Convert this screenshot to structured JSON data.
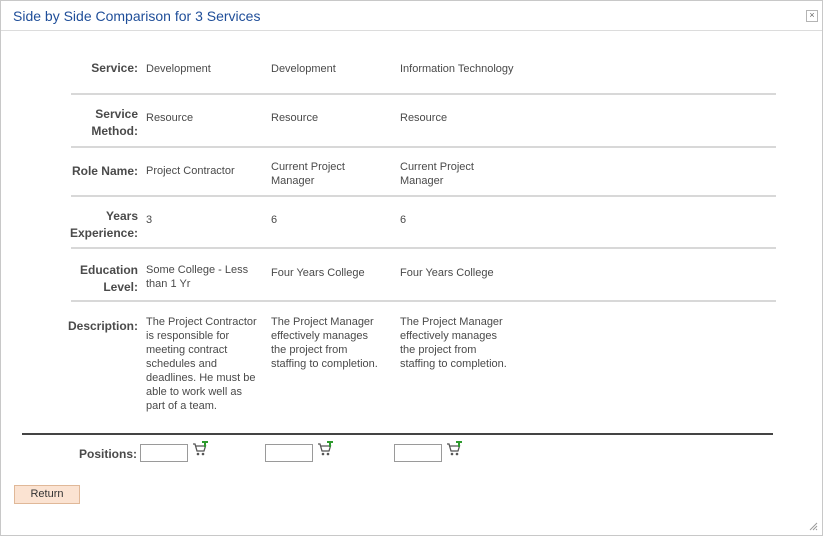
{
  "dialog": {
    "title": "Side by Side Comparison for 3 Services",
    "close_glyph": "×"
  },
  "rows": [
    {
      "label": "Service:",
      "values": [
        "Development",
        "Development",
        "Information Technology"
      ]
    },
    {
      "label": "Service Method:",
      "values": [
        "Resource",
        "Resource",
        "Resource"
      ]
    },
    {
      "label": "Role Name:",
      "values": [
        "Project Contractor",
        "Current Project Manager",
        "Current Project Manager"
      ]
    },
    {
      "label": "Years Experience:",
      "values": [
        "3",
        "6",
        "6"
      ]
    },
    {
      "label": "Education Level:",
      "values": [
        "Some College - Less than 1 Yr",
        "Four Years College",
        "Four Years College"
      ]
    },
    {
      "label": "Description:",
      "values": [
        "The Project Contractor is responsible for meeting contract schedules and deadlines.  He must be able to work well as part of a team.",
        "The Project Manager effectively manages the project from staffing to completion.",
        "The Project Manager effectively manages the project from staffing to completion."
      ]
    }
  ],
  "positions": {
    "label": "Positions:",
    "values": [
      "",
      "",
      ""
    ],
    "icon": "add-to-cart-icon"
  },
  "buttons": {
    "return": "Return"
  },
  "colors": {
    "title": "#1f4e99",
    "return_bg": "#fbe3d2",
    "return_border": "#e0b898",
    "cart_plus": "#2e9a2e"
  }
}
